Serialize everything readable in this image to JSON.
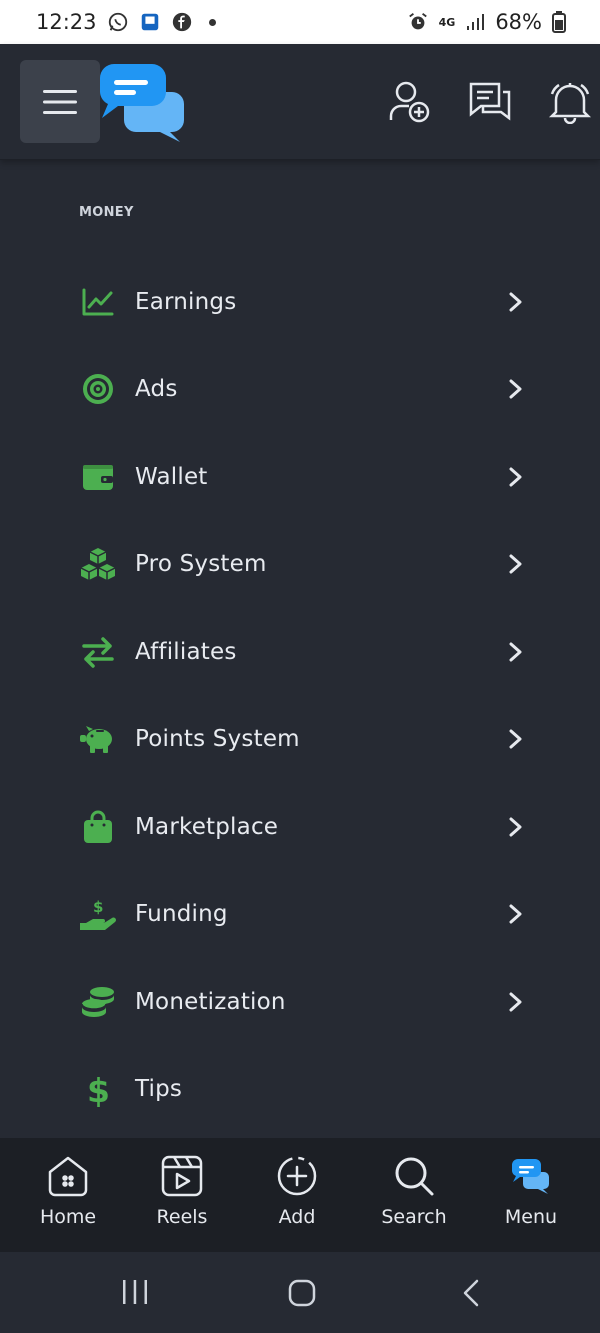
{
  "status_bar": {
    "time": "12:23",
    "network": "4G",
    "battery": "68%"
  },
  "app_bar": {
    "icons": [
      "hamburger-icon",
      "app-logo",
      "add-user-icon",
      "messages-icon",
      "bell-icon"
    ]
  },
  "money_section": {
    "title": "MONEY",
    "items": [
      {
        "label": "Earnings",
        "icon": "chart-line-icon",
        "has_chevron": true
      },
      {
        "label": "Ads",
        "icon": "target-icon",
        "has_chevron": true
      },
      {
        "label": "Wallet",
        "icon": "wallet-icon",
        "has_chevron": true
      },
      {
        "label": "Pro System",
        "icon": "cubes-icon",
        "has_chevron": true
      },
      {
        "label": "Affiliates",
        "icon": "exchange-icon",
        "has_chevron": true
      },
      {
        "label": "Points System",
        "icon": "piggy-bank-icon",
        "has_chevron": true
      },
      {
        "label": "Marketplace",
        "icon": "shopping-bag-icon",
        "has_chevron": true
      },
      {
        "label": "Funding",
        "icon": "hand-dollar-icon",
        "has_chevron": true
      },
      {
        "label": "Monetization",
        "icon": "coins-icon",
        "has_chevron": true
      },
      {
        "label": "Tips",
        "icon": "dollar-icon",
        "has_chevron": false
      }
    ]
  },
  "bottom_nav": {
    "items": [
      {
        "label": "Home",
        "icon": "home-icon"
      },
      {
        "label": "Reels",
        "icon": "reels-icon"
      },
      {
        "label": "Add",
        "icon": "add-circle-icon"
      },
      {
        "label": "Search",
        "icon": "search-icon"
      },
      {
        "label": "Menu",
        "icon": "app-logo-icon"
      }
    ]
  },
  "colors": {
    "accent_green": "#4caf50",
    "brand_blue": "#2196f3",
    "background": "#262a33"
  }
}
